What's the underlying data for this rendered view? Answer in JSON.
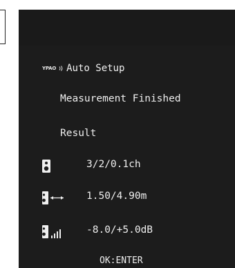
{
  "screen": {
    "logo_text": "YPAO",
    "title": "Auto Setup",
    "message": "Measurement Finished",
    "result_label": "Result",
    "results": [
      {
        "icon": "speaker-icon",
        "value": "3/2/0.1ch"
      },
      {
        "icon": "speaker-distance-icon",
        "value": "1.50/4.90m"
      },
      {
        "icon": "speaker-level-icon",
        "value": "-8.0/+5.0dB"
      }
    ],
    "footer": "OK:ENTER"
  },
  "colors": {
    "background": "#1c1c1c",
    "text": "#efefef"
  }
}
